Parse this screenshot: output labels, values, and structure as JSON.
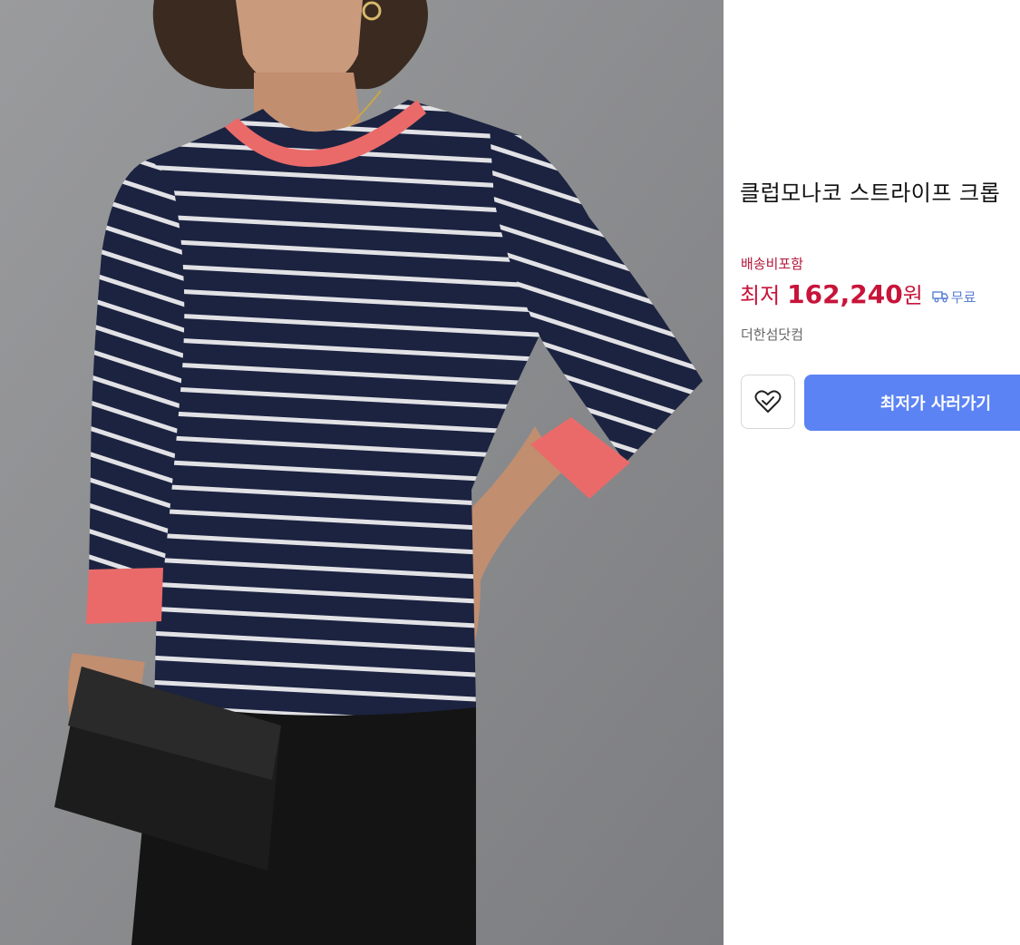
{
  "product": {
    "title": "클럽모나코 스트라이프 크롭",
    "image_alt": "striped crew-neck sweater product photo"
  },
  "pricing": {
    "shipping_note": "배송비포함",
    "price_prefix": "최저",
    "price_amount": "162,240",
    "price_unit": "원",
    "delivery_label": "무료",
    "delivery_icon": "truck-icon"
  },
  "seller": {
    "name": "더한섬닷컴"
  },
  "actions": {
    "wish_icon": "heart-check-icon",
    "buy_label": "최저가 사러가기"
  },
  "colors": {
    "price_red": "#c8143a",
    "shipping_red": "#b5173a",
    "button_blue": "#5b83f4",
    "delivery_blue": "#5b7fd6"
  }
}
